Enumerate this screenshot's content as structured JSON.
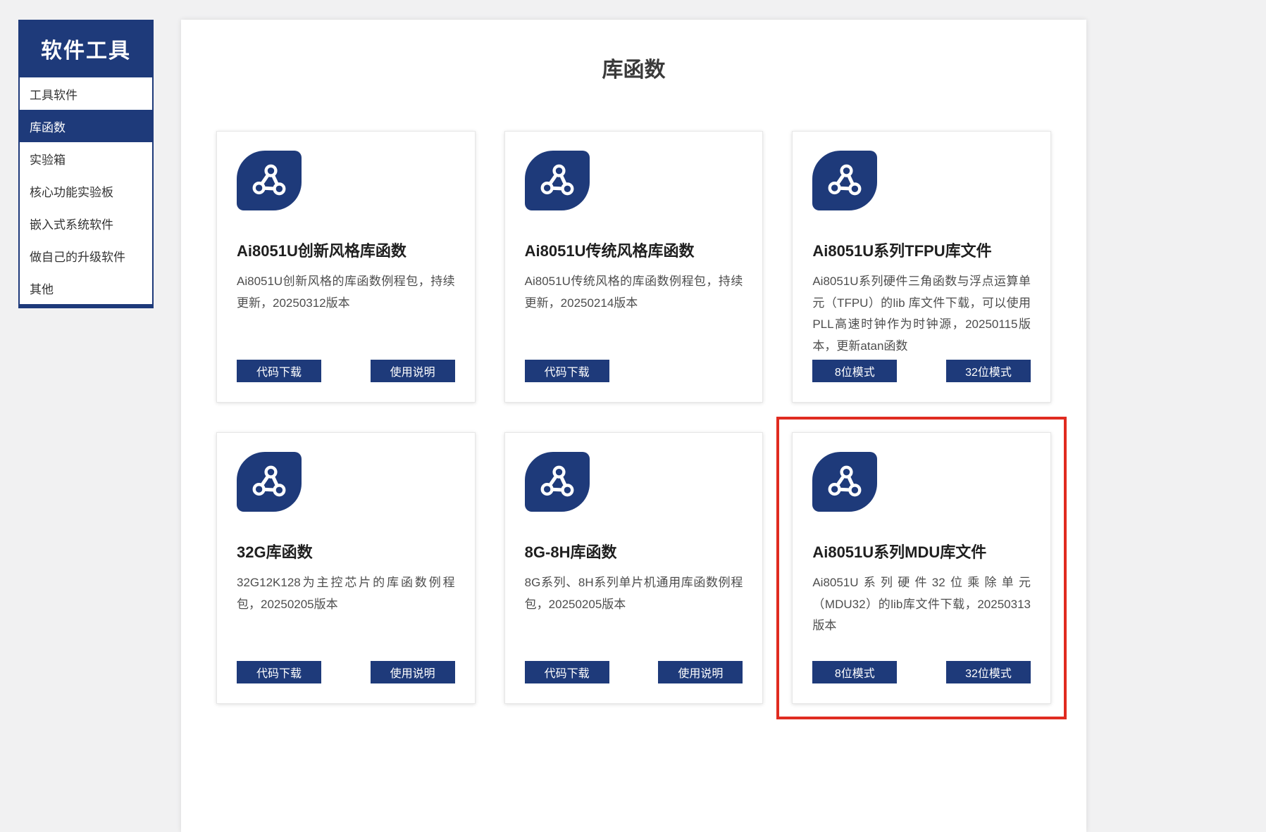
{
  "colors": {
    "brand_blue": "#1e3a7a",
    "highlight_red": "#e02b20",
    "page_background": "#f1f1f2",
    "heading_text": "#3a3a3a"
  },
  "sidebar": {
    "title": "软件工具",
    "items": [
      {
        "label": "工具软件",
        "active": false
      },
      {
        "label": "库函数",
        "active": true
      },
      {
        "label": "实验箱",
        "active": false
      },
      {
        "label": "核心功能实验板",
        "active": false
      },
      {
        "label": "嵌入式系统软件",
        "active": false
      },
      {
        "label": "做自己的升级软件",
        "active": false
      },
      {
        "label": "其他",
        "active": false
      }
    ]
  },
  "main": {
    "heading": "库函数",
    "cards": [
      {
        "title": "Ai8051U创新风格库函数",
        "description": "Ai8051U创新风格的库函数例程包，持续更新，20250312版本",
        "buttons": [
          "代码下载",
          "使用说明"
        ],
        "highlighted": false
      },
      {
        "title": "Ai8051U传统风格库函数",
        "description": "Ai8051U传统风格的库函数例程包，持续更新，20250214版本",
        "buttons": [
          "代码下载"
        ],
        "highlighted": false
      },
      {
        "title": "Ai8051U系列TFPU库文件",
        "description": "Ai8051U系列硬件三角函数与浮点运算单元（TFPU）的lib 库文件下载，可以使用PLL高速时钟作为时钟源，20250115版本，更新atan函数",
        "buttons": [
          "8位模式",
          "32位模式"
        ],
        "highlighted": false
      },
      {
        "title": "32G库函数",
        "description": "32G12K128为主控芯片的库函数例程包，20250205版本",
        "buttons": [
          "代码下载",
          "使用说明"
        ],
        "highlighted": false
      },
      {
        "title": "8G-8H库函数",
        "description": "8G系列、8H系列单片机通用库函数例程包，20250205版本",
        "buttons": [
          "代码下载",
          "使用说明"
        ],
        "highlighted": false
      },
      {
        "title": "Ai8051U系列MDU库文件",
        "description": "Ai8051U系列硬件32位乘除单元（MDU32）的lib库文件下载，20250313版本",
        "buttons": [
          "8位模式",
          "32位模式"
        ],
        "highlighted": true
      }
    ]
  }
}
